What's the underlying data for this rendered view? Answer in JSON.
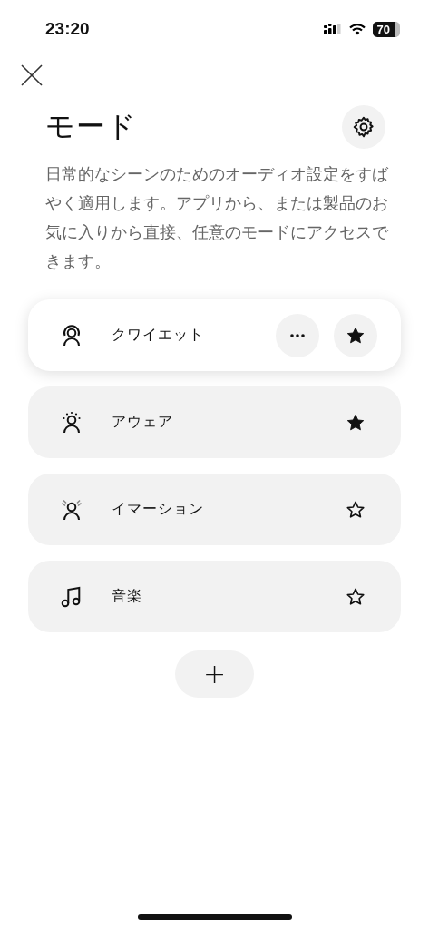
{
  "status_bar": {
    "time": "23:20",
    "battery": "70"
  },
  "title": "モード",
  "description": "日常的なシーンのためのオーディオ設定をすばやく適用します。アプリから、または製品のお気に入りから直接、任意のモードにアクセスできます。",
  "modes": [
    {
      "name": "クワイエット",
      "kind": "quiet",
      "selected": true,
      "favorite": true
    },
    {
      "name": "アウェア",
      "kind": "aware",
      "selected": false,
      "favorite": true
    },
    {
      "name": "イマーション",
      "kind": "immersion",
      "selected": false,
      "favorite": false
    },
    {
      "name": "音楽",
      "kind": "music",
      "selected": false,
      "favorite": false
    }
  ],
  "add_button": {
    "label": "+"
  }
}
